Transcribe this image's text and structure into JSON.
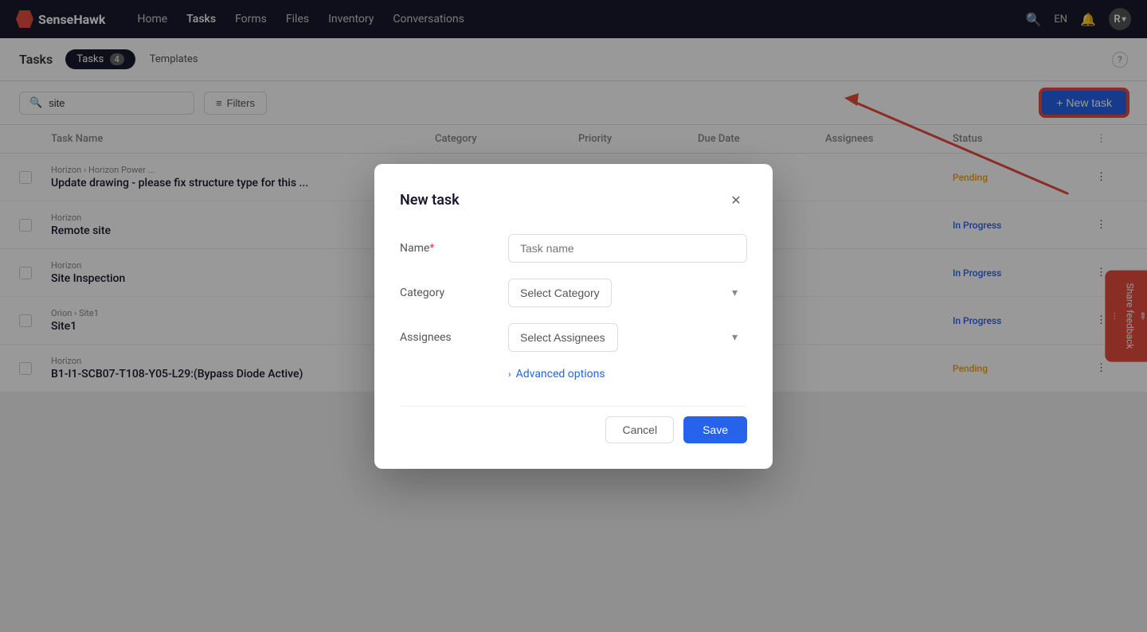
{
  "navbar": {
    "logo_text": "SenseHawk",
    "nav_items": [
      {
        "label": "Home",
        "active": false
      },
      {
        "label": "Tasks",
        "active": true
      },
      {
        "label": "Forms",
        "active": false
      },
      {
        "label": "Files",
        "active": false
      },
      {
        "label": "Inventory",
        "active": false
      },
      {
        "label": "Conversations",
        "active": false
      }
    ],
    "lang": "EN",
    "avatar_label": "R"
  },
  "page_header": {
    "title": "Tasks",
    "tabs": [
      {
        "label": "Tasks",
        "count": "4",
        "active": true
      },
      {
        "label": "Templates",
        "count": "",
        "active": false
      }
    ]
  },
  "toolbar": {
    "search_placeholder": "site",
    "search_value": "site",
    "filter_label": "Filters",
    "new_task_label": "+ New task"
  },
  "table": {
    "columns": [
      "",
      "Task Name",
      "Category",
      "Priority",
      "Due Date",
      "Assignees",
      "Status",
      ""
    ],
    "rows": [
      {
        "breadcrumb": "Horizon › Horizon Power ...",
        "name": "Update drawing - please fix structure type for this ...",
        "status": "Pending",
        "status_class": "status-pending"
      },
      {
        "breadcrumb": "Horizon",
        "name": "Remote site",
        "status": "In Progress",
        "status_class": "status-inprogress"
      },
      {
        "breadcrumb": "Horizon",
        "name": "Site Inspection",
        "status": "In Progress",
        "status_class": "status-inprogress"
      },
      {
        "breadcrumb": "Orion › Site1",
        "name": "Site1",
        "status": "In Progress",
        "status_class": "status-inprogress"
      },
      {
        "breadcrumb": "Horizon",
        "name": "B1-I1-SCB07-T108-Y05-L29:(Bypass Diode Active)",
        "status": "Pending",
        "status_class": "status-pending"
      }
    ]
  },
  "modal": {
    "title": "New task",
    "fields": {
      "name_label": "Name",
      "name_placeholder": "Task name",
      "category_label": "Category",
      "category_placeholder": "Select Category",
      "assignees_label": "Assignees",
      "assignees_placeholder": "Select Assignees"
    },
    "advanced_options_label": "Advanced options",
    "cancel_label": "Cancel",
    "save_label": "Save"
  },
  "share_feedback": {
    "icon": "✏",
    "label": "Share feedback",
    "dots": "..."
  }
}
